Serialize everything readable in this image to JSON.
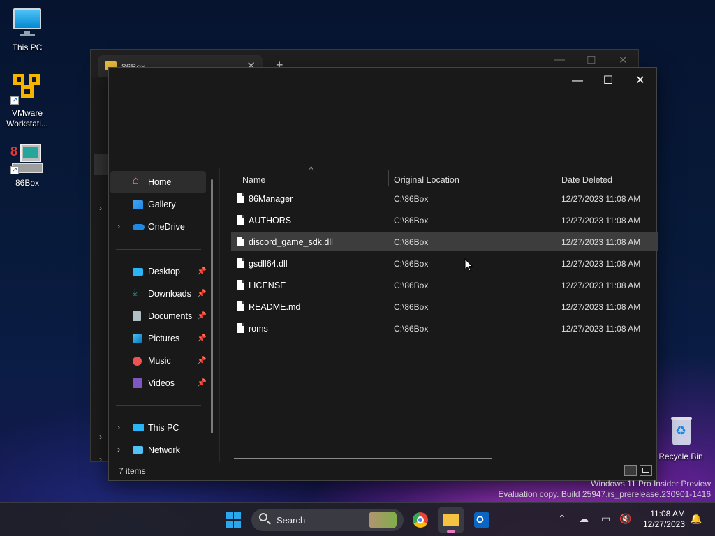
{
  "desktop": {
    "icons": [
      {
        "label": "This PC"
      },
      {
        "label": "VMware Workstati..."
      },
      {
        "label": "86Box"
      },
      {
        "label": "Recycle Bin"
      }
    ]
  },
  "back_window": {
    "tab_title": "86Box",
    "new_tab": "+",
    "tab_close": "✕"
  },
  "window": {
    "controls": {
      "minimize": "—",
      "maximize": "☐",
      "close": "✕"
    },
    "nav": {
      "items": [
        {
          "label": "Home"
        },
        {
          "label": "Gallery"
        },
        {
          "label": "OneDrive"
        },
        {
          "label": "Desktop"
        },
        {
          "label": "Downloads"
        },
        {
          "label": "Documents"
        },
        {
          "label": "Pictures"
        },
        {
          "label": "Music"
        },
        {
          "label": "Videos"
        },
        {
          "label": "This PC"
        },
        {
          "label": "Network"
        }
      ]
    },
    "columns": {
      "name": "Name",
      "location": "Original Location",
      "date": "Date Deleted"
    },
    "files": [
      {
        "name": "86Manager",
        "location": "C:\\86Box",
        "date": "12/27/2023 11:08 AM"
      },
      {
        "name": "AUTHORS",
        "location": "C:\\86Box",
        "date": "12/27/2023 11:08 AM"
      },
      {
        "name": "discord_game_sdk.dll",
        "location": "C:\\86Box",
        "date": "12/27/2023 11:08 AM"
      },
      {
        "name": "gsdll64.dll",
        "location": "C:\\86Box",
        "date": "12/27/2023 11:08 AM"
      },
      {
        "name": "LICENSE",
        "location": "C:\\86Box",
        "date": "12/27/2023 11:08 AM"
      },
      {
        "name": "README.md",
        "location": "C:\\86Box",
        "date": "12/27/2023 11:08 AM"
      },
      {
        "name": "roms",
        "location": "C:\\86Box",
        "date": "12/27/2023 11:08 AM"
      }
    ],
    "status": {
      "item_count": "7 items"
    }
  },
  "watermark": {
    "line1": "Windows 11 Pro Insider Preview",
    "line2": "Evaluation copy. Build 25947.rs_prerelease.230901-1416"
  },
  "taskbar": {
    "search_label": "Search",
    "time": "11:08 AM",
    "date": "12/27/2023"
  },
  "colors": {
    "accent": "#0078d4",
    "selected_row": "#3d3d3d",
    "folder": "#f0c040"
  }
}
